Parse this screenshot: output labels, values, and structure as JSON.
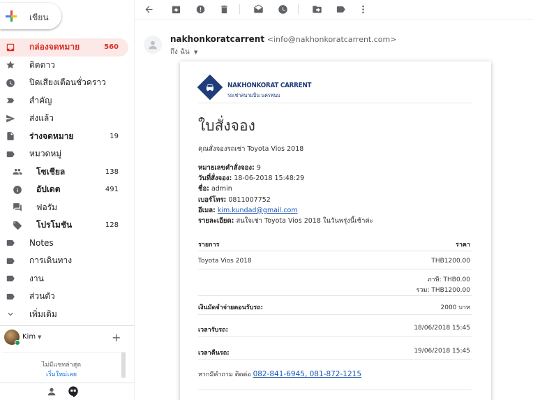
{
  "compose": {
    "label": "เขียน"
  },
  "nav": [
    {
      "label": "กล่องจดหมาย",
      "count": "560",
      "icon": "inbox-icon",
      "active": true,
      "bold": true
    },
    {
      "label": "ติดดาว",
      "count": "",
      "icon": "star-icon"
    },
    {
      "label": "ปิดเสียงเตือนชั่วคราว",
      "count": "",
      "icon": "clock-icon"
    },
    {
      "label": "สำคัญ",
      "count": "",
      "icon": "important-icon"
    },
    {
      "label": "ส่งแล้ว",
      "count": "",
      "icon": "send-icon"
    },
    {
      "label": "ร่างจดหมาย",
      "count": "19",
      "icon": "draft-icon",
      "bold": true
    },
    {
      "label": "หมวดหมู่",
      "count": "",
      "icon": "label-icon"
    },
    {
      "label": "โซเชียล",
      "count": "138",
      "icon": "people-icon",
      "sub": true,
      "bold": true
    },
    {
      "label": "อัปเดต",
      "count": "491",
      "icon": "info-icon",
      "sub": true,
      "bold": true
    },
    {
      "label": "ฟอรัม",
      "count": "",
      "icon": "forum-icon",
      "sub": true
    },
    {
      "label": "โปรโมชัน",
      "count": "128",
      "icon": "tag-icon",
      "sub": true,
      "bold": true
    },
    {
      "label": "Notes",
      "count": "",
      "icon": "label-icon"
    },
    {
      "label": "การเดินทาง",
      "count": "",
      "icon": "label-icon"
    },
    {
      "label": "งาน",
      "count": "",
      "icon": "label-icon"
    },
    {
      "label": "ส่วนตัว",
      "count": "",
      "icon": "label-icon"
    },
    {
      "label": "เพิ่มเติม",
      "count": "",
      "icon": "chevron-down-icon"
    }
  ],
  "hangouts": {
    "user": "Kim",
    "no_chats": "ไม่มีแชทล่าสุด",
    "start_new": "เริ่มใหม่เลย"
  },
  "email": {
    "sender_name": "nakhonkoratcarrent",
    "sender_address": "<info@nakhonkoratcarrent.com>",
    "to_me": "ถึง ฉัน",
    "logo_line1": "NAKHONKORAT CARRENT",
    "logo_line2": "รถเช่าสนามบิน นครพนม",
    "title": "ใบสั่งจอง",
    "intro": "คุณสั่งจองรถเช่า Toyota Vios 2018",
    "details": {
      "order_no_label": "หมายเลขคำสั่งจอง:",
      "order_no": "9",
      "order_date_label": "วันที่สั่งจอง:",
      "order_date": "18-06-2018 15:48:29",
      "name_label": "ชื่อ:",
      "name": "admin",
      "phone_label": "เบอร์โทร:",
      "phone": "0811007752",
      "email_label": "อีเมล:",
      "email": "kim.kundad@gmail.com",
      "note_label": "รายละเอียด:",
      "note": "สนใจเช่า Toyota Vios 2018 ในวันพรุ่งนี้เช้าค่ะ"
    },
    "table": {
      "col_item": "รายการ",
      "col_price": "ราคา",
      "item": "Toyota Vios 2018",
      "item_price": "THB1200.00",
      "tax": "ภาษี: THB0.00",
      "total": "รวม: THB1200.00",
      "deposit_label": "เงินมัดจำจ่ายตอนรับรถ:",
      "deposit": "2000 บาท",
      "pickup_label": "เวลารับรถ:",
      "pickup": "18/06/2018 15:45",
      "return_label": "เวลาคืนรถ:",
      "return": "19/06/2018 15:45"
    },
    "contact_text": "หากมีคำถาม ติดต่อ",
    "contact_phones": "082-841-6945, 081-872-1215"
  }
}
